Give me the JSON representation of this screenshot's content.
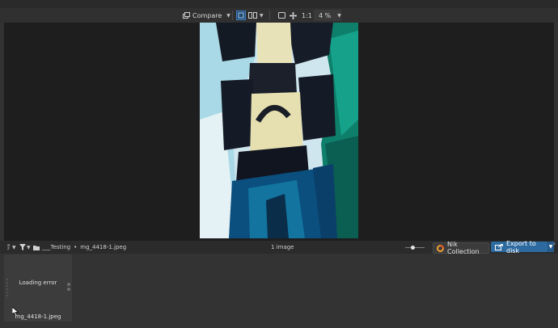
{
  "toolbar": {
    "compare_label": "Compare",
    "ratio_label": "1:1",
    "zoom_value": "4 %"
  },
  "filmstrip_bar": {
    "sort_label": "a z",
    "path_folder": "___Testing",
    "path_separator": "•",
    "path_file": "mg_4418-1.jpeg",
    "image_count": "1 image",
    "nik_label": "Nik Collection",
    "export_label": "Export to disk"
  },
  "thumbnail": {
    "error_text": "Loading error",
    "filename": "mg_4418-1.jpeg"
  },
  "colors": {
    "accent": "#2d6aa0",
    "active_view": "#3c7fc4",
    "viewer_bg": "#1e1e1e",
    "panel_bg": "#333333"
  }
}
